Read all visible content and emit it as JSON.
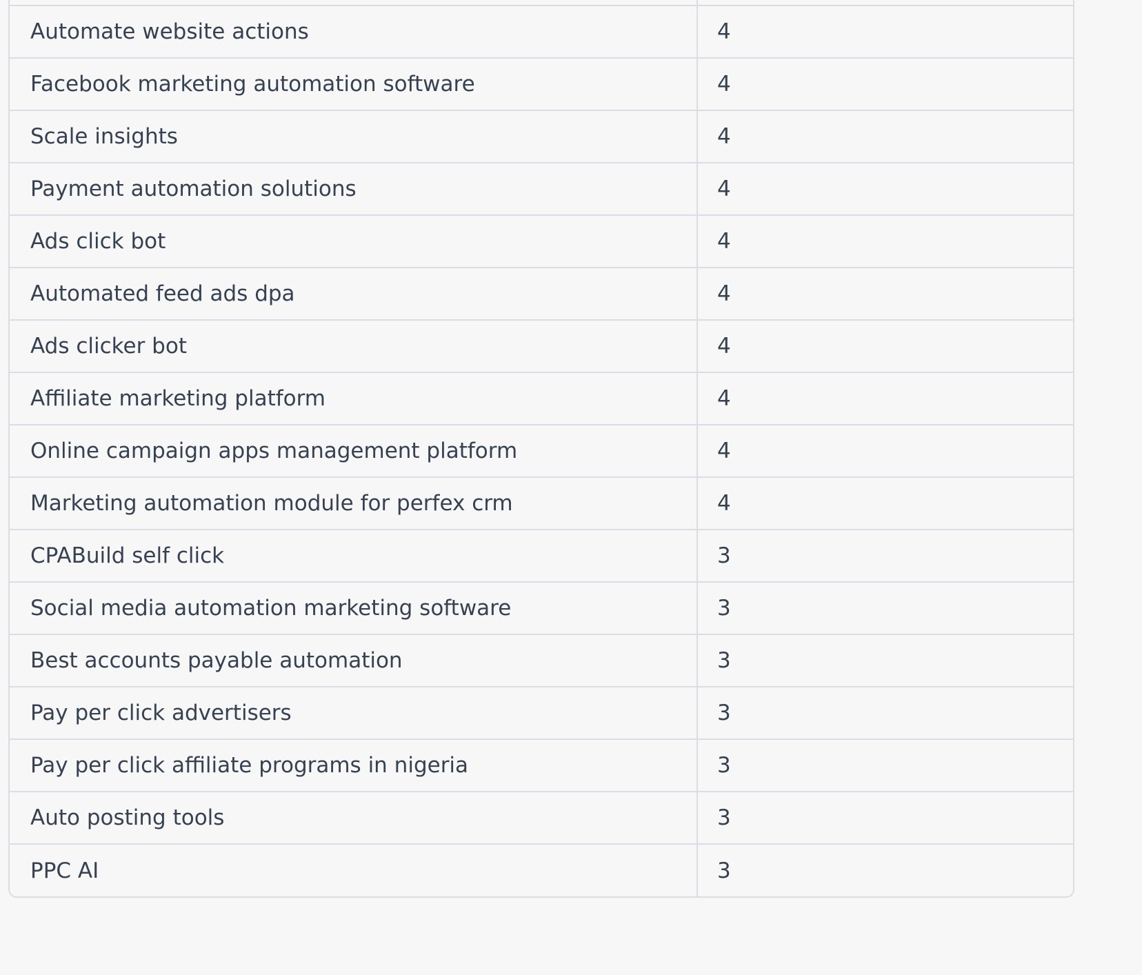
{
  "table": {
    "rows": [
      {
        "keyword": "",
        "value": ""
      },
      {
        "keyword": "Automate website actions",
        "value": "4"
      },
      {
        "keyword": "Facebook marketing automation software",
        "value": "4"
      },
      {
        "keyword": "Scale insights",
        "value": "4"
      },
      {
        "keyword": "Payment automation solutions",
        "value": "4"
      },
      {
        "keyword": "Ads click bot",
        "value": "4"
      },
      {
        "keyword": "Automated feed ads dpa",
        "value": "4"
      },
      {
        "keyword": "Ads clicker bot",
        "value": "4"
      },
      {
        "keyword": "Affiliate marketing platform",
        "value": "4"
      },
      {
        "keyword": "Online campaign apps management platform",
        "value": "4"
      },
      {
        "keyword": "Marketing automation module for perfex crm",
        "value": "4"
      },
      {
        "keyword": "CPABuild self click",
        "value": "3"
      },
      {
        "keyword": "Social media automation marketing software",
        "value": "3"
      },
      {
        "keyword": "Best accounts payable automation",
        "value": "3"
      },
      {
        "keyword": "Pay per click advertisers",
        "value": "3"
      },
      {
        "keyword": "Pay per click affiliate programs in nigeria",
        "value": "3"
      },
      {
        "keyword": "Auto posting tools",
        "value": "3"
      },
      {
        "keyword": "PPC AI",
        "value": "3"
      }
    ]
  }
}
